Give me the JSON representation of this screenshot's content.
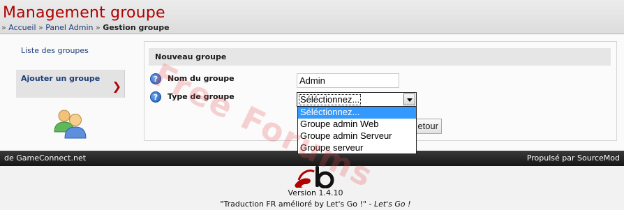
{
  "header": {
    "title": "Management groupe",
    "breadcrumb": {
      "sep": "»",
      "items": [
        "Accueil",
        "Panel Admin",
        "Gestion groupe"
      ]
    }
  },
  "sidebar": {
    "items": [
      {
        "label": "Liste des groupes"
      },
      {
        "label": "Ajouter un groupe"
      }
    ],
    "active_arrow": "❯",
    "icon": "users-icon"
  },
  "panel": {
    "title": "Nouveau groupe",
    "fields": {
      "name_label": "Nom du groupe",
      "name_value": "Admin",
      "type_label": "Type de groupe",
      "type_selected": "Séléctionnez..."
    },
    "help_glyph": "?",
    "dropdown_options": [
      "Séléctionnez...",
      "Groupe admin Web",
      "Groupe admin Serveur",
      "Groupe serveur"
    ],
    "back_button": "etour"
  },
  "watermark": "Free Forums",
  "footer": {
    "left": "de GameConnect.net",
    "right": "Propulsé par SourceMod",
    "version": "Version 1.4.10",
    "credit_main": "\"Traduction FR amélioré by Let's Go !\" - ",
    "credit_italic": "Let's Go !"
  },
  "colors": {
    "title_red": "#b00000",
    "link_blue": "#1c3d7a",
    "selection_blue": "#3399ff"
  }
}
